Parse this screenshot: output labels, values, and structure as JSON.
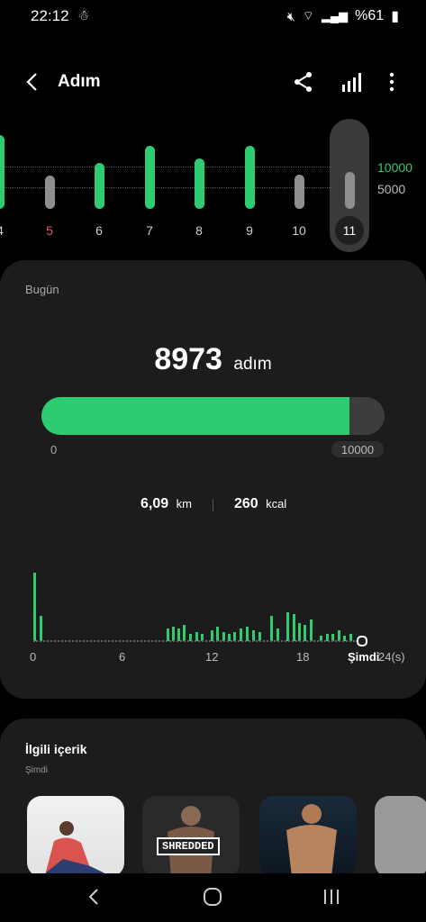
{
  "status": {
    "time": "22:12",
    "battery": "%61"
  },
  "header": {
    "title": "Adım"
  },
  "weekly": {
    "days": [
      "4",
      "5",
      "6",
      "7",
      "8",
      "9",
      "10",
      "11"
    ],
    "goal_labels": [
      "10000",
      "5000"
    ],
    "selected_day": "11"
  },
  "today": {
    "label": "Bugün",
    "steps": "8973",
    "steps_unit": "adım",
    "progress": 0.8973,
    "progress_min": "0",
    "progress_goal": "10000",
    "distance_value": "6,09",
    "distance_unit": "km",
    "calories_value": "260",
    "calories_unit": "kcal"
  },
  "hourly": {
    "x_labels": [
      "0",
      "6",
      "12",
      "18",
      "Şimdi",
      "24(s)"
    ]
  },
  "related": {
    "title": "İlgili içerik",
    "subtitle": "Şimdi",
    "thumb2_label": "SHREDDED"
  },
  "colors": {
    "accent": "#2ecc71",
    "background": "#000000",
    "card": "#1c1c1c"
  }
}
